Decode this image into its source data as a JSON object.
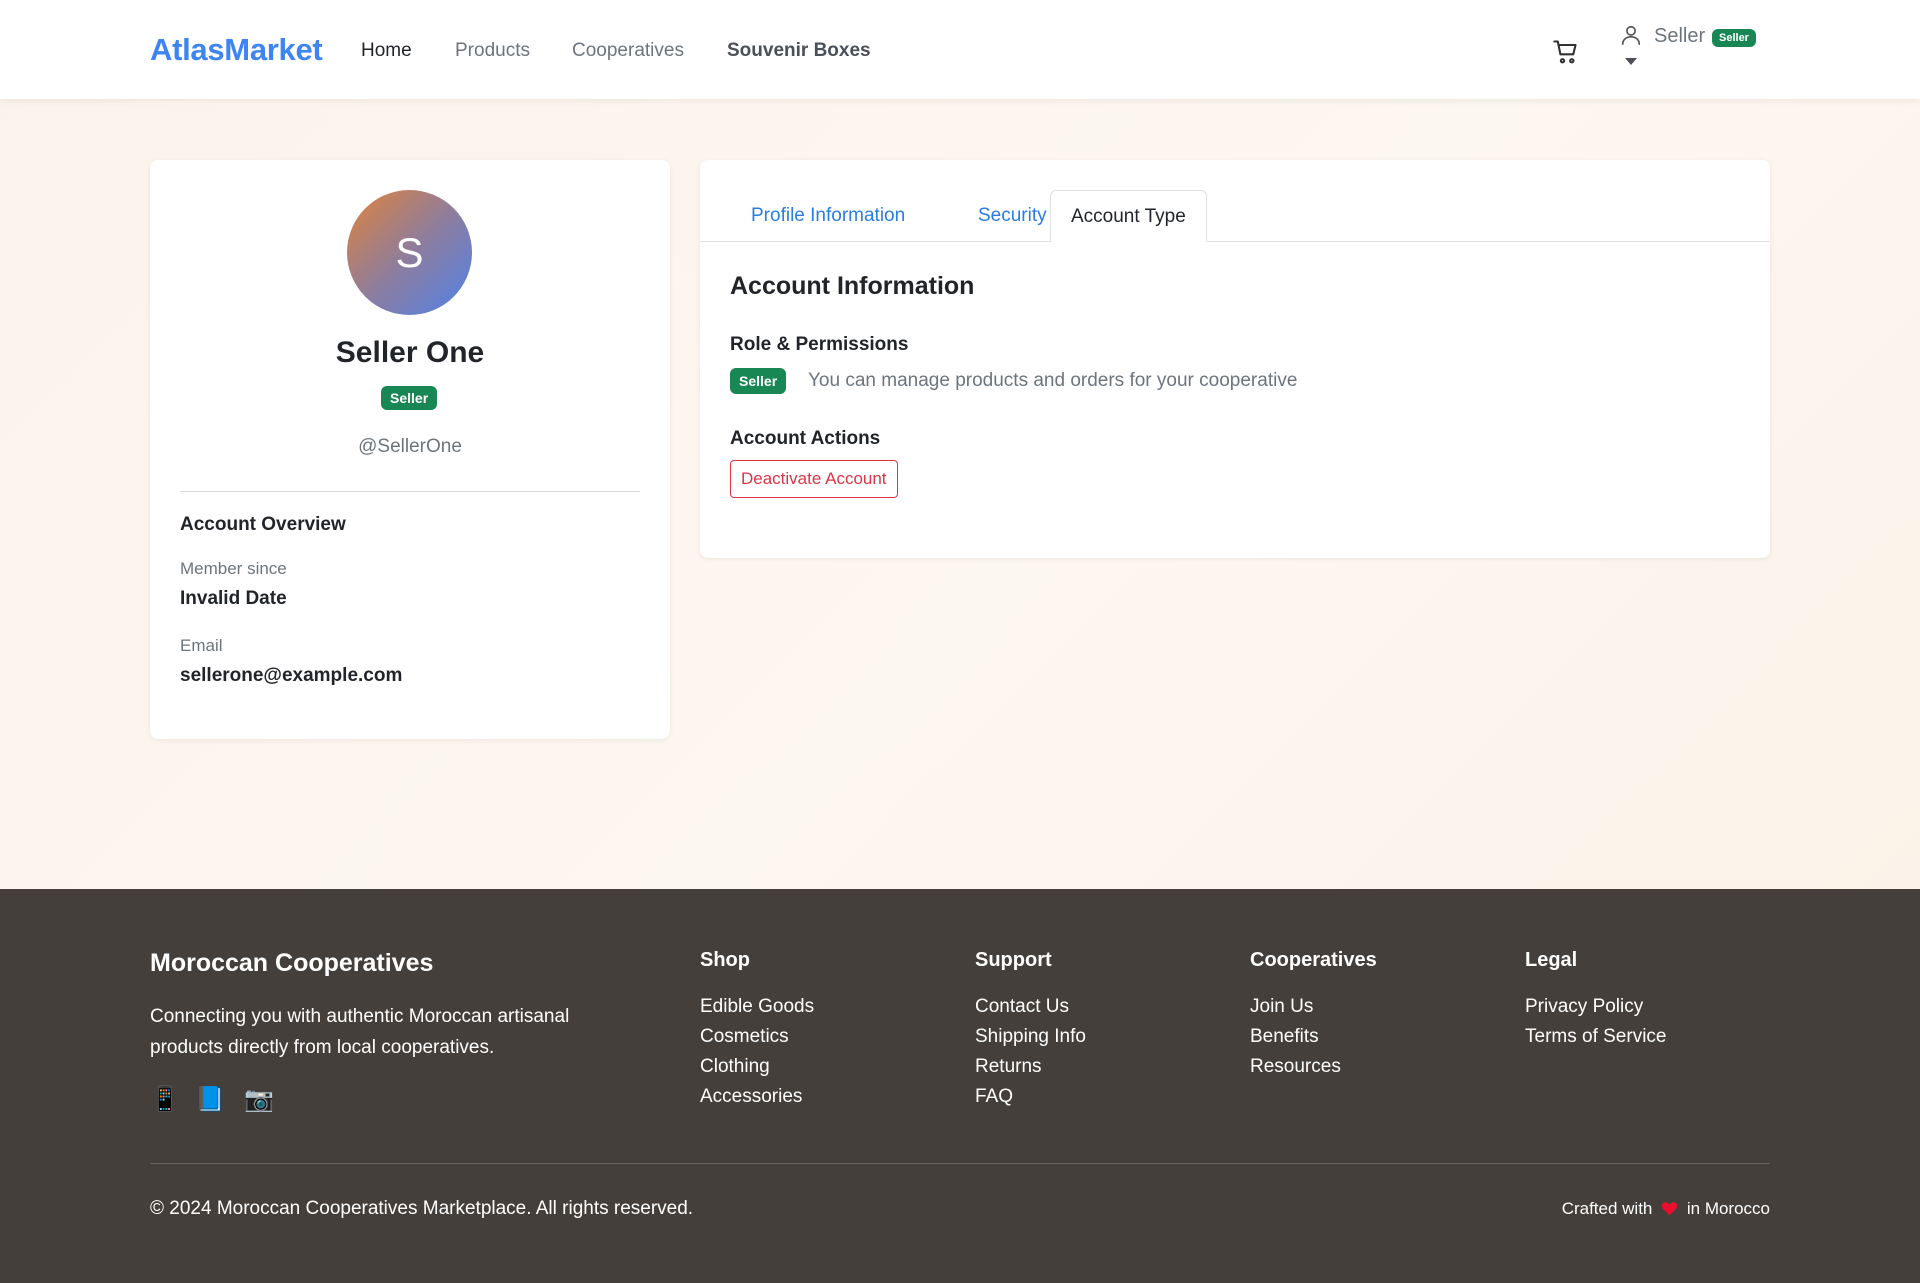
{
  "nav": {
    "brand": "AtlasMarket",
    "links": [
      "Home",
      "Products",
      "Cooperatives",
      "Souvenir Boxes"
    ],
    "user_label": "Seller",
    "user_badge": "Seller"
  },
  "profile": {
    "avatar_initial": "S",
    "name": "Seller One",
    "role_badge": "Seller",
    "handle": "@SellerOne",
    "overview_title": "Account Overview",
    "member_since_label": "Member since",
    "member_since_value": "Invalid Date",
    "email_label": "Email",
    "email_value": "sellerone@example.com"
  },
  "account": {
    "tabs": [
      "Profile Information",
      "Security",
      "Account Type"
    ],
    "active_tab": "Account Type",
    "title": "Account Information",
    "role_heading": "Role & Permissions",
    "role_badge": "Seller",
    "role_description": "You can manage products and orders for your cooperative",
    "actions_heading": "Account Actions",
    "deactivate_label": "Deactivate Account"
  },
  "footer": {
    "brand": "Moroccan Cooperatives",
    "description": "Connecting you with authentic Moroccan artisanal products directly from local cooperatives.",
    "social_icons": [
      "mobile-phone-icon",
      "book-icon",
      "camera-icon"
    ],
    "social_glyphs": [
      "📱",
      "📘",
      "📷"
    ],
    "columns": [
      {
        "title": "Shop",
        "links": [
          "Edible Goods",
          "Cosmetics",
          "Clothing",
          "Accessories"
        ]
      },
      {
        "title": "Support",
        "links": [
          "Contact Us",
          "Shipping Info",
          "Returns",
          "FAQ"
        ]
      },
      {
        "title": "Cooperatives",
        "links": [
          "Join Us",
          "Benefits",
          "Resources"
        ]
      },
      {
        "title": "Legal",
        "links": [
          "Privacy Policy",
          "Terms of Service"
        ]
      }
    ],
    "copyright": "© 2024 Moroccan Cooperatives Marketplace. All rights reserved.",
    "crafted_prefix": "Crafted with",
    "crafted_suffix": "in Morocco"
  },
  "colors": {
    "brand": "#3d84f5",
    "success_badge": "#198754",
    "danger": "#dc3545",
    "footer_bg": "#443f3b",
    "tab_link": "#2a7de1"
  }
}
